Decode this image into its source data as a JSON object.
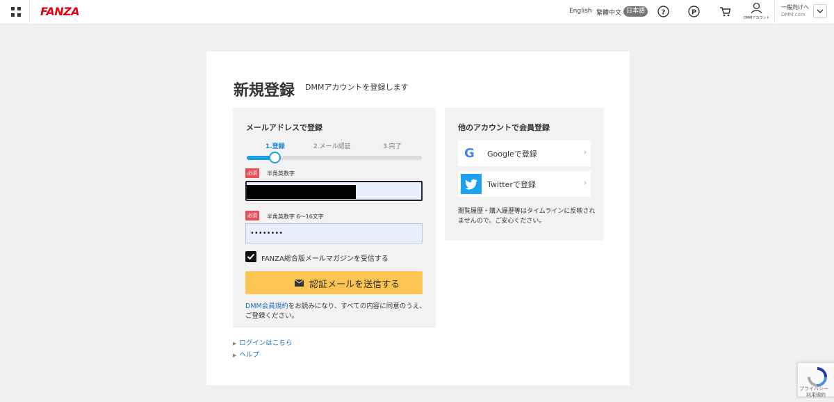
{
  "header": {
    "logo": "FANZA",
    "lang_en": "English",
    "lang_zh": "繁體中文",
    "lang_ja": "日本語",
    "account_label": "DMMアカウント",
    "site_main": "一般向けへ",
    "site_sub": "DMM.com"
  },
  "page": {
    "title": "新規登録",
    "subtitle": "DMMアカウントを登録します"
  },
  "email_form": {
    "heading": "メールアドレスで登録",
    "steps": [
      "1.登録",
      "2.メール認証",
      "3.完了"
    ],
    "progress": 0.17,
    "required_badge": "必須",
    "email_note": "半角英数字",
    "email_value": "",
    "password_note": "半角英数字 6〜16文字",
    "password_value": "••••••••",
    "newsletter_label": "FANZA総合版メールマガジンを受信する",
    "newsletter_checked": true,
    "submit_label": "認証メールを送信する",
    "terms_link": "DMM会員規約",
    "terms_text": "をお読みになり、すべての内容に同意のうえ、ご登録ください。"
  },
  "links": {
    "login": "ログインはこちら",
    "help": "ヘルプ"
  },
  "other_accounts": {
    "heading": "他のアカウントで会員登録",
    "google_label": "Googleで登録",
    "google_icon_letter": "G",
    "twitter_label": "Twitterで登録",
    "note": "閲覧履歴・購入履歴等はタイムラインに反映されませんので、ご安心ください。"
  },
  "recaptcha": {
    "line1": "プライバシー",
    "line2": "利用規約"
  },
  "colors": {
    "brand": "#e60012",
    "accent_blue": "#1a9fe0",
    "submit": "#fcc452",
    "required": "#e8505b",
    "twitter": "#1da1f2"
  }
}
